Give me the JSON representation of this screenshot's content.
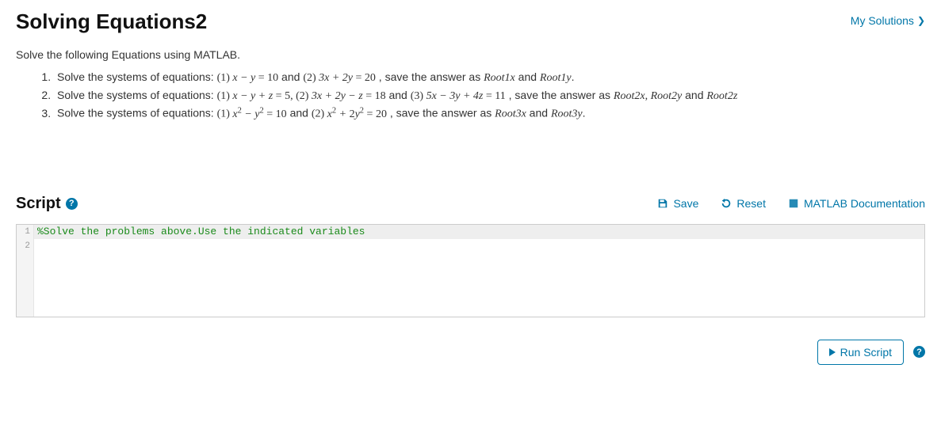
{
  "header": {
    "title": "Solving Equations2",
    "my_solutions": "My Solutions"
  },
  "intro": "Solve the following Equations using MATLAB.",
  "problems": [
    {
      "lead": "Solve the systems of equations: ",
      "tail_prefix": " ,  save the answer as ",
      "var1": "Root1x",
      "var_sep": " and ",
      "var2": "Root1y",
      "period": "."
    },
    {
      "lead": "Solve the systems of equations: ",
      "tail_prefix": "  , save the answer as ",
      "var1": "Root2x",
      "sep12": ", ",
      "var2": "Root2y",
      "var_sep": " and ",
      "var3": "Root2z"
    },
    {
      "lead": "Solve the systems of equations: ",
      "tail_prefix": "  ,  save the answer as ",
      "var1": "Root3x",
      "var_sep": " and ",
      "var2": "Root3y",
      "period": "."
    }
  ],
  "equations": {
    "p1": {
      "e1_lhs": "x − y",
      "e1_rhs": " = 10",
      "and": " and ",
      "e2_lhs": "3x + 2y",
      "e2_rhs": " = 20"
    },
    "p2": {
      "e1_lhs": "x − y + z",
      "e1_rhs": " = 5",
      "sep1": ", ",
      "e2_lhs": "3x + 2y − z",
      "e2_rhs": " = 18",
      "and": " and ",
      "e3_lhs": "5x − 3y + 4z",
      "e3_rhs": " = 11"
    },
    "p3": {
      "and": " and "
    }
  },
  "labels": {
    "eq1": "(1)  ",
    "eq2": "(2) ",
    "eq3": "(3) "
  },
  "script": {
    "heading": "Script",
    "help": "?",
    "save": "Save",
    "reset": "Reset",
    "docs": "MATLAB Documentation"
  },
  "editor": {
    "line1_num": "1",
    "line1_text": "%Solve the problems above.Use the indicated variables",
    "line2_num": "2",
    "line2_text": ""
  },
  "footer": {
    "run": "Run Script",
    "help": "?"
  }
}
